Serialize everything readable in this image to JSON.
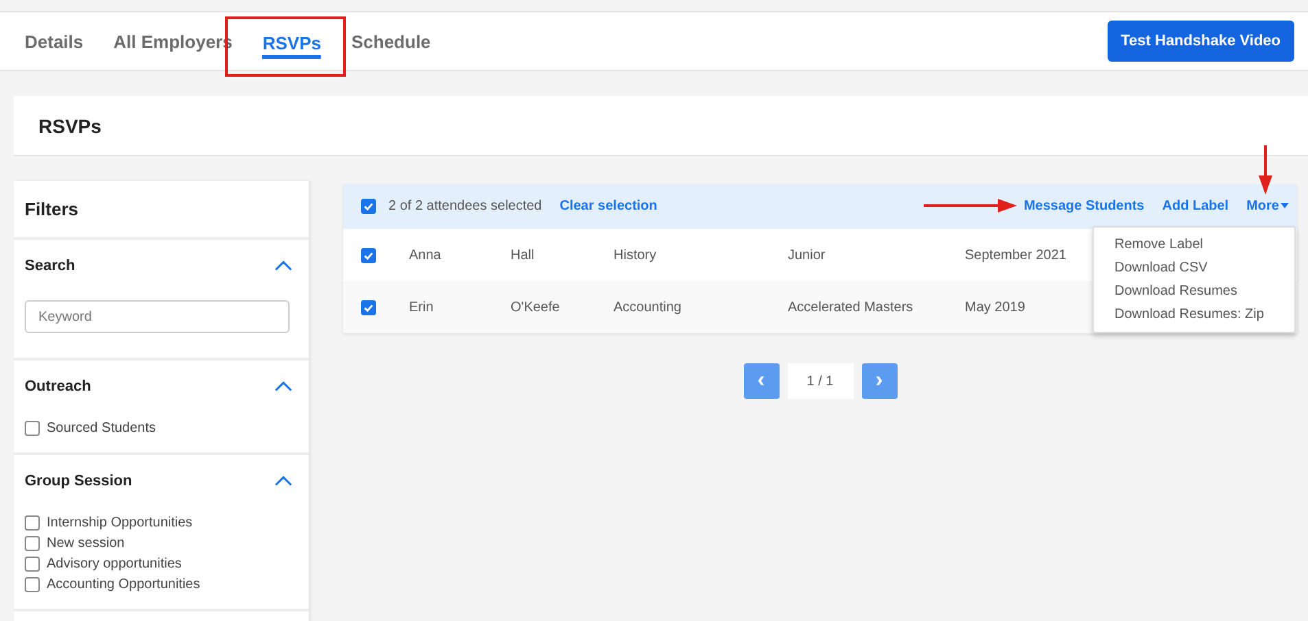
{
  "tabs": [
    {
      "label": "Details",
      "selected": false
    },
    {
      "label": "All Employers",
      "selected": false
    },
    {
      "label": "RSVPs",
      "selected": true
    },
    {
      "label": "Schedule",
      "selected": false
    }
  ],
  "header_button": "Test Handshake Video",
  "page_title": "RSVPs",
  "filters": {
    "title": "Filters",
    "sections": [
      {
        "title": "Search",
        "expanded": true,
        "kind": "search",
        "placeholder": "Keyword"
      },
      {
        "title": "Outreach",
        "expanded": true,
        "kind": "checklist",
        "options": [
          {
            "label": "Sourced Students",
            "checked": false
          }
        ]
      },
      {
        "title": "Group Session",
        "expanded": true,
        "kind": "checklist",
        "options": [
          {
            "label": "Internship Opportunities",
            "checked": false
          },
          {
            "label": "New session",
            "checked": false
          },
          {
            "label": "Advisory opportunities",
            "checked": false
          },
          {
            "label": "Accounting Opportunities",
            "checked": false
          }
        ]
      }
    ]
  },
  "selection_bar": {
    "checked": true,
    "summary": "2 of 2 attendees selected",
    "clear": "Clear selection",
    "actions": [
      "Message Students",
      "Add Label",
      "More"
    ]
  },
  "rows": [
    {
      "checked": true,
      "cells": [
        "Anna",
        "Hall",
        "History",
        "Junior",
        "September 2021"
      ]
    },
    {
      "checked": true,
      "cells": [
        "Erin",
        "O'Keefe",
        "Accounting",
        "Accelerated Masters",
        "May 2019"
      ]
    }
  ],
  "more_menu": [
    "Remove Label",
    "Download CSV",
    "Download Resumes",
    "Download Resumes: Zip"
  ],
  "pagination": {
    "prev": "‹",
    "page": "1 / 1",
    "next": "›"
  }
}
